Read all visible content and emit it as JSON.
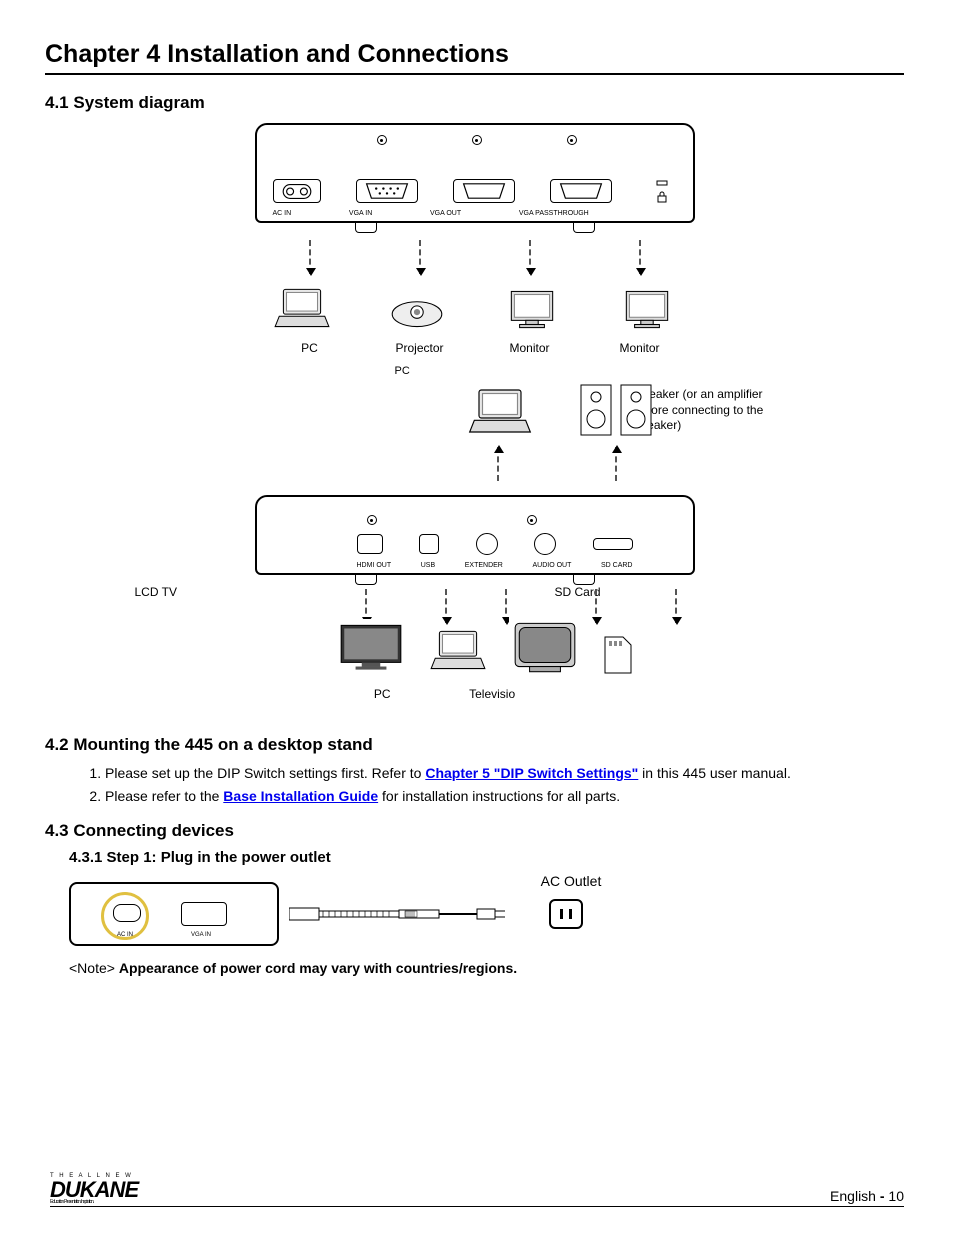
{
  "chapter": {
    "title": "Chapter 4   Installation and Connections"
  },
  "sections": {
    "s41": {
      "title": "4.1 System diagram"
    },
    "s42": {
      "title": "4.2 Mounting the 445 on a desktop stand",
      "steps": [
        {
          "prefix": "Please set up the DIP Switch settings first. Refer to ",
          "link": "Chapter 5 \"DIP Switch Settings\"",
          "suffix": " in this 445 user manual."
        },
        {
          "prefix": "Please refer to the ",
          "link": "Base Installation Guide",
          "suffix": " for installation instructions for all parts."
        }
      ]
    },
    "s43": {
      "title": "4.3 Connecting devices"
    },
    "s431": {
      "title": "4.3.1 Step 1: Plug in the power outlet",
      "outlet_label": "AC Outlet",
      "note_prefix": "<Note> ",
      "note_body": "Appearance of power cord may vary with countries/regions."
    }
  },
  "diagram1": {
    "ports": [
      "AC IN",
      "VGA IN",
      "VGA OUT",
      "VGA PASSTHROUGH"
    ],
    "labels": [
      "PC",
      "Projector",
      "Monitor",
      "Monitor"
    ]
  },
  "diagram2": {
    "top_labels": {
      "pc": "PC",
      "speaker": "Speaker (or an amplifier before connecting to the speaker)"
    },
    "ports": [
      "HDMI OUT",
      "USB",
      "EXTENDER",
      "AUDIO OUT",
      "SD CARD"
    ],
    "side_labels": {
      "lcd": "LCD TV",
      "sd": "SD Card"
    },
    "bottom_labels": [
      "PC",
      "Televisio"
    ]
  },
  "plug_panel": {
    "ports": [
      "AC IN",
      "VGA IN"
    ]
  },
  "footer": {
    "brand_small": "T H E  A L L  N E W",
    "brand": "DUKANE",
    "brand_tag": "Education. Presentation. Inspiration.",
    "lang": "English",
    "sep": " - ",
    "pageno": "10"
  }
}
